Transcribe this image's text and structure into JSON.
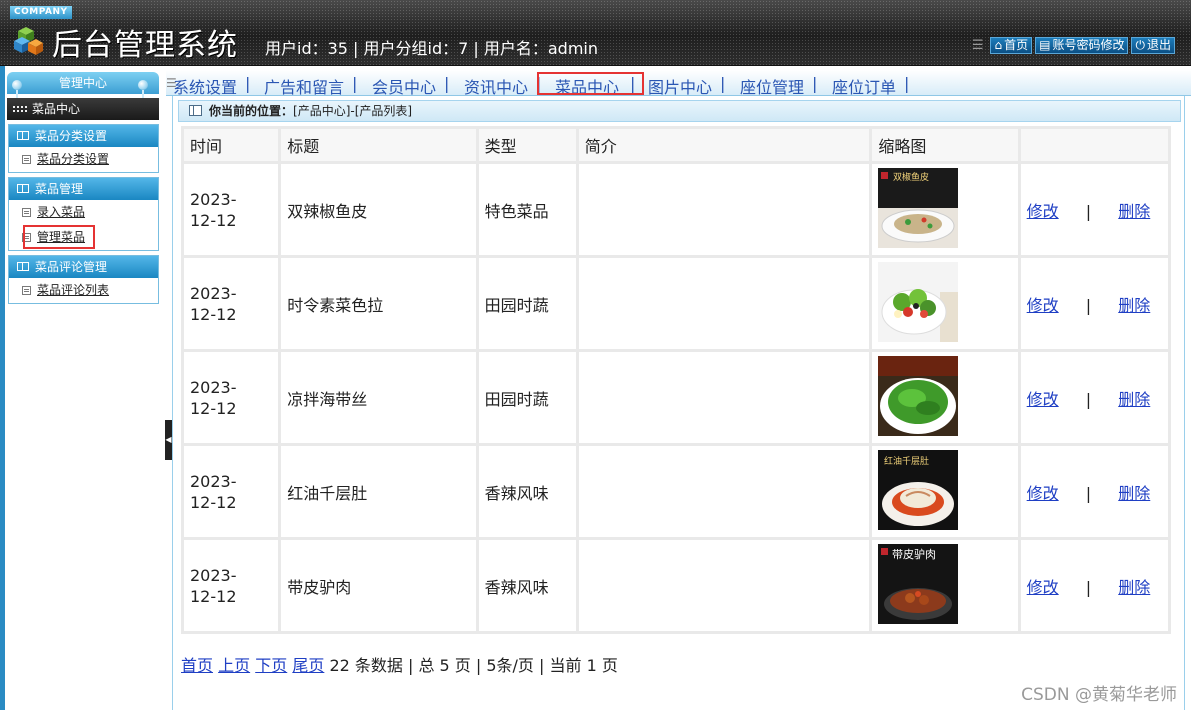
{
  "header": {
    "company": "COMPANY",
    "title": "后台管理系统",
    "user_info": "用户id：35 | 用户分组id：7 | 用户名：admin",
    "buttons": {
      "home": "首页",
      "password": "账号密码修改",
      "logout": "退出"
    }
  },
  "sidebar": {
    "manage_center": "管理中心",
    "current_menu": "菜品中心",
    "groups": [
      {
        "title": "菜品分类设置",
        "items": [
          "菜品分类设置"
        ]
      },
      {
        "title": "菜品管理",
        "items": [
          "录入菜品",
          "管理菜品"
        ]
      },
      {
        "title": "菜品评论管理",
        "items": [
          "菜品评论列表"
        ]
      }
    ]
  },
  "nav": [
    "系统设置",
    "广告和留言",
    "会员中心",
    "资讯中心",
    "菜品中心",
    "图片中心",
    "座位管理",
    "座位订单"
  ],
  "nav_separator": "|",
  "breadcrumb": {
    "label": "你当前的位置：",
    "path": "[产品中心]-[产品列表]"
  },
  "table": {
    "headers": [
      "时间",
      "标题",
      "类型",
      "简介",
      "缩略图",
      ""
    ],
    "rows": [
      {
        "date": "2023-12-12",
        "title": "双辣椒鱼皮",
        "type": "特色菜品",
        "intro": "",
        "thumb_text": "双椒鱼皮"
      },
      {
        "date": "2023-12-12",
        "title": "时令素菜色拉",
        "type": "田园时蔬",
        "intro": "",
        "thumb_text": ""
      },
      {
        "date": "2023-12-12",
        "title": "凉拌海带丝",
        "type": "田园时蔬",
        "intro": "",
        "thumb_text": ""
      },
      {
        "date": "2023-12-12",
        "title": "红油千层肚",
        "type": "香辣风味",
        "intro": "",
        "thumb_text": "红油千层肚"
      },
      {
        "date": "2023-12-12",
        "title": "带皮驴肉",
        "type": "香辣风味",
        "intro": "",
        "thumb_text": "带皮驴肉"
      }
    ],
    "edit_label": "修改",
    "delete_label": "删除",
    "op_separator": "|"
  },
  "pager": {
    "first": "首页",
    "prev": "上页",
    "next": "下页",
    "last": "尾页",
    "summary": "22 条数据 | 总 5 页 | 5条/页 | 当前 1 页"
  },
  "watermark": "CSDN @黄菊华老师"
}
